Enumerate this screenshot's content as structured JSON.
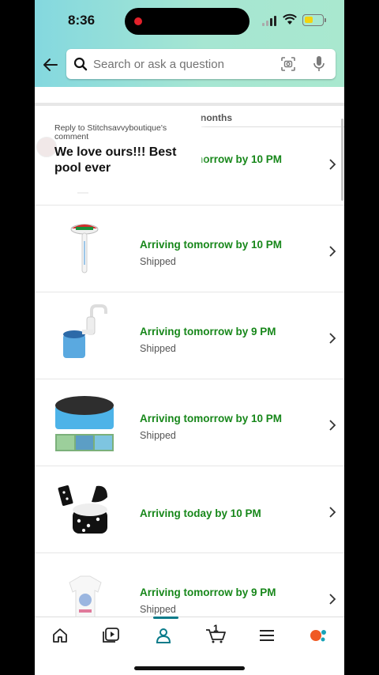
{
  "status_bar": {
    "time": "8:36"
  },
  "search": {
    "placeholder": "Search or ask a question"
  },
  "section": {
    "header_partial": "nonths"
  },
  "comment_overlay": {
    "reply_to": "Reply to Stitchsavvyboutique's comment",
    "text": "We love ours!!! Best pool ever"
  },
  "orders": [
    {
      "arrival": "Arriving tomorrow by 10 PM",
      "status": "",
      "thumb": "small-item"
    },
    {
      "arrival": "Arriving tomorrow by 10 PM",
      "status": "Shipped",
      "thumb": "pool-thermometer"
    },
    {
      "arrival": "Arriving tomorrow by 9 PM",
      "status": "Shipped",
      "thumb": "pool-skimmer"
    },
    {
      "arrival": "Arriving tomorrow by 10 PM",
      "status": "Shipped",
      "thumb": "pool-cover"
    },
    {
      "arrival": "Arriving today by 10 PM",
      "status": "",
      "thumb": "storage-bags"
    },
    {
      "arrival": "Arriving tomorrow by 9 PM",
      "status": "Shipped",
      "thumb": "tshirt"
    }
  ],
  "bottom_nav": {
    "items": [
      "home-icon",
      "video-icon",
      "account-icon",
      "cart-icon",
      "menu-icon",
      "rufus-icon"
    ],
    "active": "account-icon",
    "cart_count": "1"
  },
  "colors": {
    "accent": "#0a7b8a",
    "arrival_green": "#17871a",
    "header_gradient_start": "#84d8df",
    "header_gradient_end": "#a9e8cf"
  }
}
